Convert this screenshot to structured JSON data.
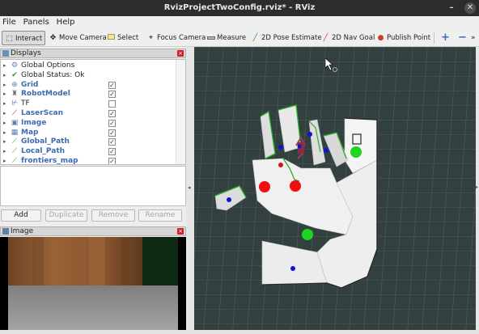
{
  "window": {
    "title": "RvizProjectTwoConfig.rviz* - RViz",
    "min_label": "–",
    "close_label": "✕"
  },
  "menu": [
    "File",
    "Panels",
    "Help"
  ],
  "toolbar": {
    "tools": [
      {
        "label": "Interact",
        "icon": "cursor-icon"
      },
      {
        "label": "Move Camera",
        "icon": "move-camera-icon"
      },
      {
        "label": "Select",
        "icon": "select-icon"
      },
      {
        "label": "Focus Camera",
        "icon": "focus-camera-icon"
      },
      {
        "label": "Measure",
        "icon": "ruler-icon"
      },
      {
        "label": "2D Pose Estimate",
        "icon": "green-arrow-icon"
      },
      {
        "label": "2D Nav Goal",
        "icon": "pink-arrow-icon"
      },
      {
        "label": "Publish Point",
        "icon": "map-pin-icon"
      }
    ],
    "zoom_in": "+",
    "zoom_out": "−",
    "more": "»"
  },
  "displays_panel": {
    "title": "Displays",
    "items": [
      {
        "label": "Global Options",
        "icon": "gear-icon",
        "checked": null
      },
      {
        "label": "Global Status: Ok",
        "icon": "checkmark-icon",
        "checked": null
      },
      {
        "label": "Grid",
        "icon": "grid-icon",
        "checked": true
      },
      {
        "label": "RobotModel",
        "icon": "robot-icon",
        "checked": true
      },
      {
        "label": "TF",
        "icon": "tf-icon",
        "checked": false
      },
      {
        "label": "LaserScan",
        "icon": "laser-icon",
        "checked": true
      },
      {
        "label": "Image",
        "icon": "image-icon",
        "checked": true
      },
      {
        "label": "Map",
        "icon": "map-icon",
        "checked": true
      },
      {
        "label": "Global_Path",
        "icon": "path-icon",
        "checked": true
      },
      {
        "label": "Local_Path",
        "icon": "path-icon",
        "checked": true
      },
      {
        "label": "frontiers_map",
        "icon": "path-icon",
        "checked": true
      }
    ],
    "buttons": {
      "add": "Add",
      "duplicate": "Duplicate",
      "remove": "Remove",
      "rename": "Rename"
    }
  },
  "image_panel": {
    "title": "Image"
  },
  "colors": {
    "accent_blue": "#3b6ab3",
    "close_red": "#d02020",
    "viewport_bg": "#2f3b3b"
  }
}
